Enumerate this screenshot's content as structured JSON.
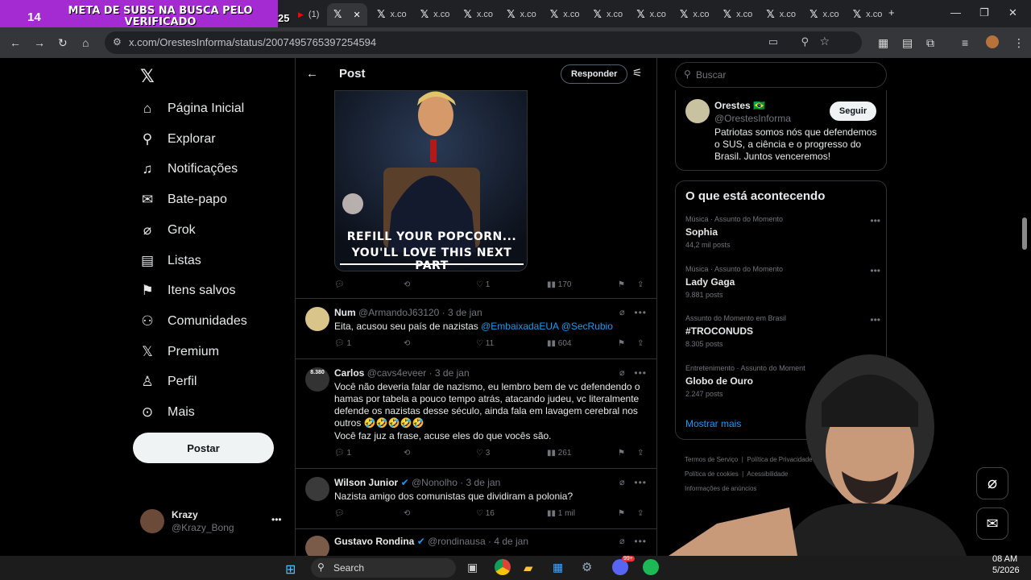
{
  "overlay": {
    "count": "14",
    "text": "META DE SUBS NA BUSCA PELO VERIFICADO"
  },
  "browser": {
    "tabs": [
      {
        "label": "Ca"
      },
      {
        "label": "(1)"
      },
      {
        "label": ""
      },
      {
        "label": "x.co"
      },
      {
        "label": "x.co"
      },
      {
        "label": "x.co"
      },
      {
        "label": "x.co"
      },
      {
        "label": "x.co"
      },
      {
        "label": "x.co"
      },
      {
        "label": "x.co"
      },
      {
        "label": "x.co"
      },
      {
        "label": "x.co"
      },
      {
        "label": "x.co"
      },
      {
        "label": "x.co"
      },
      {
        "label": "x.co"
      }
    ],
    "tab_badge": "25",
    "url": "x.com/OrestesInforma/status/2007495765397254594"
  },
  "nav": {
    "items": [
      {
        "label": "Página Inicial",
        "icon": "home-icon"
      },
      {
        "label": "Explorar",
        "icon": "search-icon"
      },
      {
        "label": "Notificações",
        "icon": "bell-icon"
      },
      {
        "label": "Bate-papo",
        "icon": "mail-icon"
      },
      {
        "label": "Grok",
        "icon": "grok-icon"
      },
      {
        "label": "Listas",
        "icon": "list-icon"
      },
      {
        "label": "Itens salvos",
        "icon": "bookmark-icon"
      },
      {
        "label": "Comunidades",
        "icon": "people-icon"
      },
      {
        "label": "Premium",
        "icon": "x-icon"
      },
      {
        "label": "Perfil",
        "icon": "person-icon"
      },
      {
        "label": "Mais",
        "icon": "more-circle-icon"
      }
    ],
    "post_button": "Postar",
    "account": {
      "name": "Krazy",
      "handle": "@Krazy_Bong"
    }
  },
  "main": {
    "header_title": "Post",
    "reply_button": "Responder",
    "image_caption_line1": "REFILL YOUR POPCORN...",
    "image_caption_line2": "YOU'LL LOVE THIS NEXT PART",
    "post_stats": {
      "replies": "",
      "reposts": "",
      "likes": "1",
      "views": "170"
    },
    "replies": [
      {
        "name": "Num",
        "handle": "@ArmandoJ63120",
        "date": "· 3 de jan",
        "verified": false,
        "text": "Eita, acusou seu país de nazistas",
        "links": "@EmbaixadaEUA @SecRubio",
        "replies": "1",
        "reposts": "",
        "likes": "11",
        "views": "604"
      },
      {
        "name": "Carlos",
        "handle": "@cavs4eveer",
        "date": "· 3 de jan",
        "verified": false,
        "text": "Você não deveria falar de nazismo, eu lembro bem de vc defendendo o hamas por tabela a pouco tempo atrás, atacando judeu, vc literalmente defende os nazistas desse século, ainda fala em lavagem cerebral nos outros 🤣🤣🤣🤣🤣",
        "text2": "Você faz juz a frase, acuse eles do que vocês são.",
        "avatar_label": "8.380",
        "replies": "1",
        "reposts": "",
        "likes": "3",
        "views": "261"
      },
      {
        "name": "Wilson Junior",
        "handle": "@Nonolho",
        "date": "· 3 de jan",
        "verified": true,
        "text": "Nazista amigo dos comunistas que dividiram a polonia?",
        "replies": "",
        "reposts": "",
        "likes": "16",
        "views": "1 mil"
      },
      {
        "name": "Gustavo Rondina",
        "handle": "@rondinausa",
        "date": "· 4 de jan",
        "verified": true
      }
    ]
  },
  "right": {
    "search_placeholder": "Buscar",
    "profile": {
      "name": "Orestes 🇧🇷",
      "handle": "@OrestesInforma",
      "follow": "Seguir",
      "bio": "Patriotas somos nós que defendemos o SUS, a ciência e o progresso do Brasil. Juntos venceremos!"
    },
    "trends_title": "O que está acontecendo",
    "trends": [
      {
        "context": "Música · Assunto do Momento",
        "name": "Sophia",
        "posts": "44,2 mil posts"
      },
      {
        "context": "Música · Assunto do Momento",
        "name": "Lady Gaga",
        "posts": "9.881 posts"
      },
      {
        "context": "Assunto do Momento em Brasil",
        "name": "#TROCONUDS",
        "posts": "8.305 posts"
      },
      {
        "context": "Entretenimento · Assunto do Moment",
        "name": "Globo de Ouro",
        "posts": "2.247 posts"
      }
    ],
    "show_more": "Mostrar mais",
    "footer": [
      "Termos de Serviço",
      "Política de Privacidade",
      "Política de cookies",
      "Acessibilidade",
      "Informações de anúncios"
    ]
  },
  "taskbar": {
    "search": "Search",
    "time": "08 AM",
    "date": "5/2026",
    "badge": "99+"
  }
}
